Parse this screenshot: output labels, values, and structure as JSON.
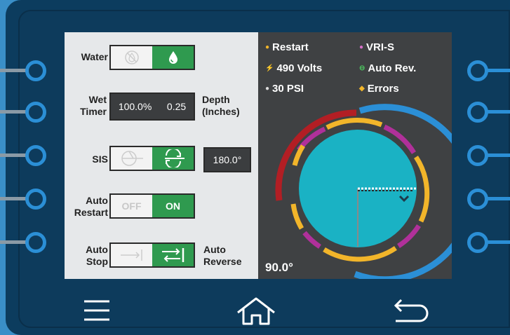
{
  "controls": {
    "water_label": "Water",
    "wet_timer_label_1": "Wet",
    "wet_timer_label_2": "Timer",
    "wet_timer_percent": "100.0%",
    "depth_value": "0.25",
    "depth_label_1": "Depth",
    "depth_label_2": "(Inches)",
    "sis_label": "SIS",
    "sis_angle": "180.0°",
    "auto_restart_label_1": "Auto",
    "auto_restart_label_2": "Restart",
    "auto_restart_off": "OFF",
    "auto_restart_on": "ON",
    "auto_stop_label_1": "Auto",
    "auto_stop_label_2": "Stop",
    "auto_reverse_label_1": "Auto",
    "auto_reverse_label_2": "Reverse"
  },
  "legend": {
    "restart": "Restart",
    "vri_s": "VRI-S",
    "volts": "490 Volts",
    "auto_rev": "Auto Rev.",
    "psi": "30 PSI",
    "errors": "Errors"
  },
  "pivot": {
    "angle_readout": "90.0°"
  },
  "colors": {
    "active_green": "#2f9a4f",
    "field_teal": "#1ab2c4",
    "accent_blue": "#2b8fd6",
    "stop_red": "#b21e24",
    "wet_magenta": "#b0309a",
    "dry_yellow": "#f2b52a"
  },
  "icons": [
    "no-water-icon",
    "water-drop-icon",
    "sis-off-icon",
    "sis-on-icon",
    "auto-stop-icon",
    "auto-reverse-icon",
    "menu-icon",
    "home-icon",
    "back-icon"
  ]
}
